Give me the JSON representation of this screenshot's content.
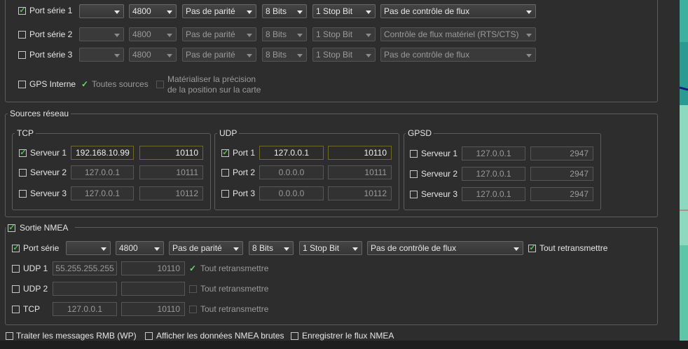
{
  "serial_ports": [
    {
      "label": "Port série 1",
      "checked": true,
      "enabled": true,
      "port": "",
      "baud": "4800",
      "parity": "Pas de parité",
      "bits": "8 Bits",
      "stop": "1 Stop Bit",
      "flow": "Pas de contrôle de flux"
    },
    {
      "label": "Port série 2",
      "checked": false,
      "enabled": false,
      "port": "",
      "baud": "4800",
      "parity": "Pas de parité",
      "bits": "8 Bits",
      "stop": "1 Stop Bit",
      "flow": "Contrôle de flux matériel (RTS/CTS)"
    },
    {
      "label": "Port série 3",
      "checked": false,
      "enabled": false,
      "port": "",
      "baud": "4800",
      "parity": "Pas de parité",
      "bits": "8 Bits",
      "stop": "1 Stop Bit",
      "flow": "Pas de contrôle de flux"
    }
  ],
  "gps": {
    "internal_label": "GPS Interne",
    "all_sources_label": "Toutes sources",
    "precision_line1": "Matérialiser la précision",
    "precision_line2": "de la position sur la carte"
  },
  "network": {
    "title": "Sources réseau",
    "tcp": {
      "title": "TCP",
      "rows": [
        {
          "label": "Serveur 1",
          "checked": true,
          "host": "192.168.10.99",
          "port": "10110"
        },
        {
          "label": "Serveur 2",
          "checked": false,
          "host": "127.0.0.1",
          "port": "10111"
        },
        {
          "label": "Serveur 3",
          "checked": false,
          "host": "127.0.0.1",
          "port": "10112"
        }
      ]
    },
    "udp": {
      "title": "UDP",
      "rows": [
        {
          "label": "Port 1",
          "checked": true,
          "host": "127.0.0.1",
          "port": "10110"
        },
        {
          "label": "Port 2",
          "checked": false,
          "host": "0.0.0.0",
          "port": "10111"
        },
        {
          "label": "Port 3",
          "checked": false,
          "host": "0.0.0.0",
          "port": "10112"
        }
      ]
    },
    "gpsd": {
      "title": "GPSD",
      "rows": [
        {
          "label": "Serveur 1",
          "checked": false,
          "host": "127.0.0.1",
          "port": "2947"
        },
        {
          "label": "Serveur 2",
          "checked": false,
          "host": "127.0.0.1",
          "port": "2947"
        },
        {
          "label": "Serveur 3",
          "checked": false,
          "host": "127.0.0.1",
          "port": "2947"
        }
      ]
    }
  },
  "nmea_output": {
    "title": "Sortie NMEA",
    "serial": {
      "label": "Port série",
      "port": "",
      "baud": "4800",
      "parity": "Pas de parité",
      "bits": "8 Bits",
      "stop": "1 Stop Bit",
      "flow": "Pas de contrôle de flux",
      "retransmit": "Tout retransmettre"
    },
    "udp1": {
      "label": "UDP 1",
      "host": "55.255.255.255",
      "port": "10110",
      "retransmit": "Tout retransmettre"
    },
    "udp2": {
      "label": "UDP 2",
      "host": "",
      "port": "",
      "retransmit": "Tout retransmettre"
    },
    "tcp": {
      "label": "TCP",
      "host": "127.0.0.1",
      "port": "10110",
      "retransmit": "Tout retransmettre"
    }
  },
  "footer": {
    "rmb": "Traiter les messages RMB (WP)",
    "raw": "Afficher les données NMEA brutes",
    "record": "Enregistrer le flux NMEA"
  },
  "colors": {
    "accent_check": "#4ec24e",
    "active_field_border": "#6e6a2a",
    "map_sidebar": "#2f8f8f"
  }
}
